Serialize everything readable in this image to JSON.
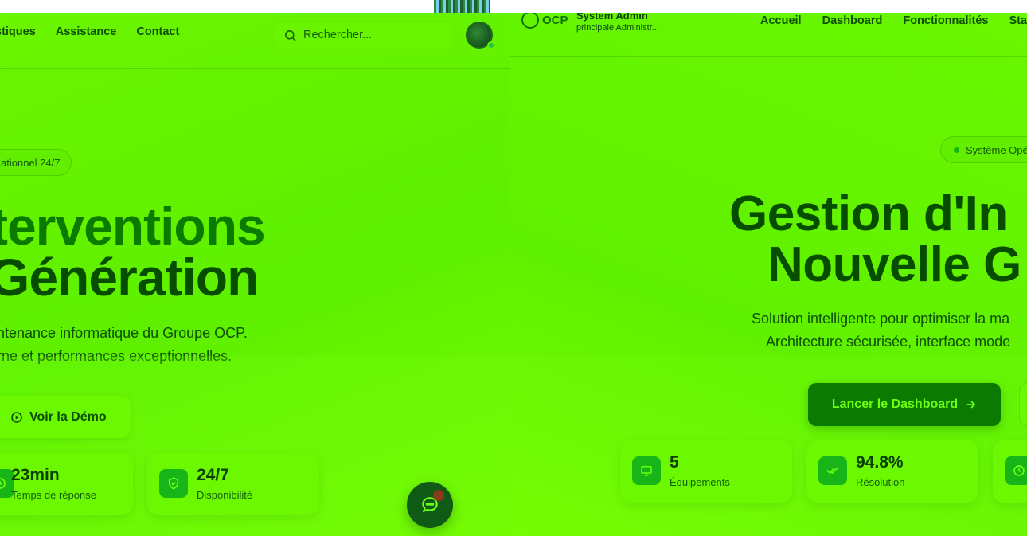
{
  "left": {
    "nav": [
      "stiques",
      "Assistance",
      "Contact"
    ],
    "search_placeholder": "Rechercher...",
    "badge": "ationnel 24/7",
    "hero_line1": "terventions",
    "hero_line2": "énération",
    "hero_prefix2": "G",
    "subtitle_line1": "ntenance informatique du Groupe OCP.",
    "subtitle_line2": "rne et performances exceptionnelles.",
    "demo_button": "Voir la Démo",
    "stats": [
      {
        "value": "23min",
        "label": "Temps de réponse",
        "icon": "clock-icon"
      },
      {
        "value": "24/7",
        "label": "Disponibilité",
        "icon": "shield-check-icon"
      }
    ]
  },
  "right": {
    "logo_text": "OCP",
    "user_name": "System Admin",
    "user_role": "principale Administr...",
    "nav": [
      "Accueil",
      "Dashboard",
      "Fonctionnalités",
      "Stati"
    ],
    "badge": "Système Opé",
    "hero_line1": "Gestion d'In",
    "hero_line2": "Nouvelle G",
    "subtitle_line1": "Solution intelligente pour optimiser la ma",
    "subtitle_line2": "Architecture sécurisée, interface mode",
    "dashboard_button": "Lancer le Dashboard",
    "stats": [
      {
        "value": "5",
        "label": "Équipements",
        "icon": "monitor-icon"
      },
      {
        "value": "94.8%",
        "label": "Résolution",
        "icon": "double-check-icon"
      }
    ]
  },
  "colors": {
    "background": "#66f200",
    "accent_dark": "#0b7a00",
    "icon_green": "#17b517"
  }
}
